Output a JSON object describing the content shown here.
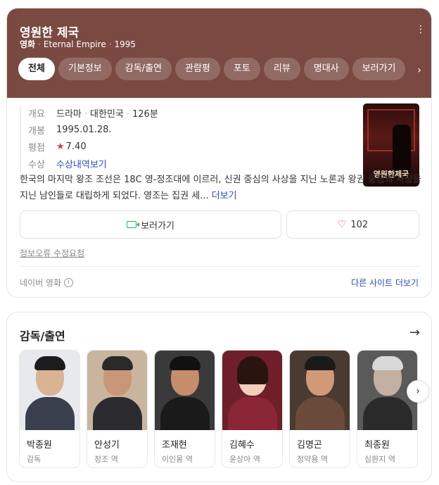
{
  "movie": {
    "title": "영원한 제국",
    "category": "영화",
    "english_title": "Eternal Empire",
    "year": "1995"
  },
  "tabs": [
    "전체",
    "기본정보",
    "감독/출연",
    "관람평",
    "포토",
    "리뷰",
    "명대사",
    "보러가기"
  ],
  "info": {
    "overview_label": "개요",
    "genre": "드라마",
    "country": "대한민국",
    "runtime": "126분",
    "release_label": "개봉",
    "release_date": "1995.01.28.",
    "rating_label": "평점",
    "rating": "7.40",
    "award_label": "수상",
    "award_link": "수상내역보기"
  },
  "poster": {
    "text": "영원한제국"
  },
  "description": {
    "text": "한국의 마지막 왕조 조선은 18C 영-정조대에 이르러, 신권 중심의 사상을 지닌 노론과 왕권 중심의 사상을 지닌 남인들로 대립하게 되었다. 영조는 집권 세...",
    "more": "더보기"
  },
  "actions": {
    "watch": "보러가기",
    "like_count": "102"
  },
  "report_link": "정보오류 수정요청",
  "source": "네이버 영화",
  "other_sites": "다른 사이트 더보기",
  "cast_section": {
    "title": "감독/출연",
    "people": [
      {
        "name": "박종원",
        "role": "감독"
      },
      {
        "name": "안성기",
        "role": "정조 역"
      },
      {
        "name": "조재현",
        "role": "이인몽 역"
      },
      {
        "name": "김혜수",
        "role": "윤상아 역"
      },
      {
        "name": "김명곤",
        "role": "정약용 역"
      },
      {
        "name": "최종원",
        "role": "심환지 역"
      }
    ]
  },
  "colors": {
    "header_bg": "#7a4a42",
    "link": "#2a4fb8",
    "star": "#e0394b"
  }
}
